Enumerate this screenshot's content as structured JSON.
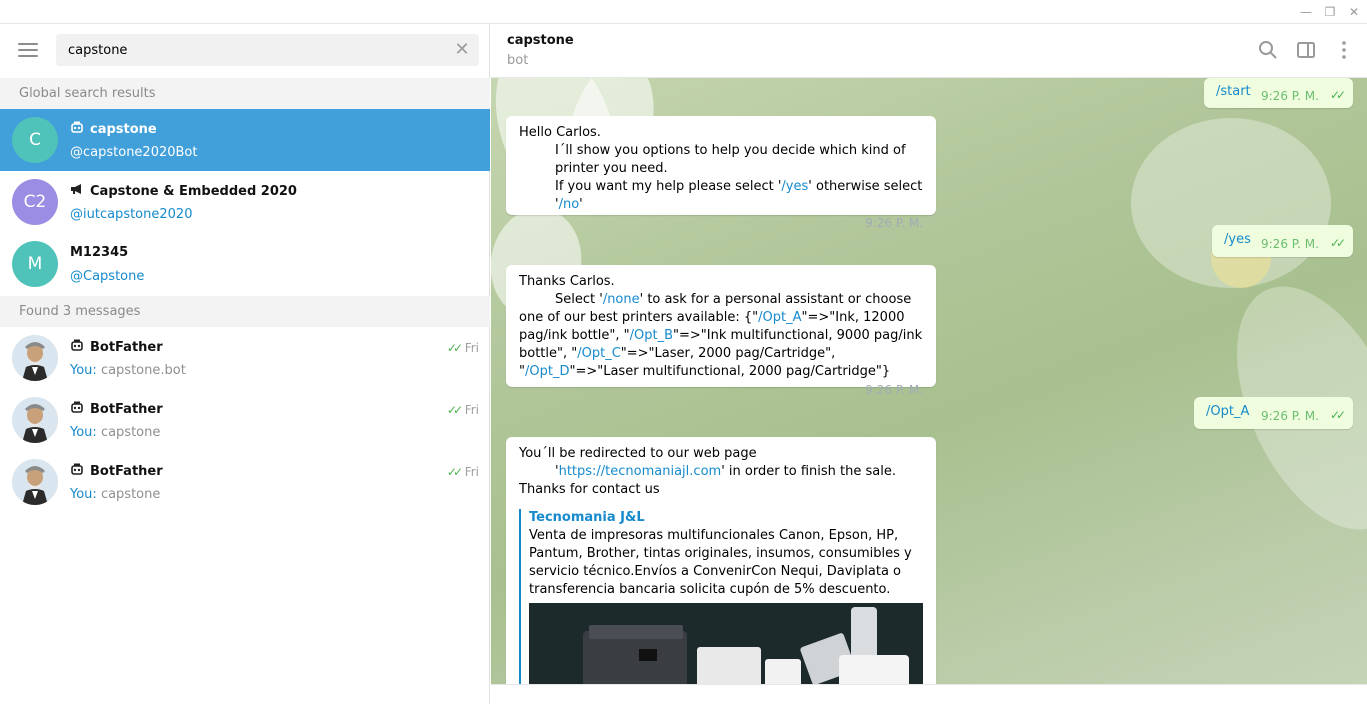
{
  "window": {
    "minimize": "—",
    "restore": "❐",
    "close": "✕"
  },
  "search": {
    "value": "capstone",
    "clear_icon": "✕"
  },
  "sections": {
    "global": "Global search results",
    "messages": "Found 3 messages"
  },
  "global_results": [
    {
      "avatar": "C",
      "avatar_color": "#4fc3b9",
      "icon": "bot",
      "name": "capstone",
      "username": "@capstone2020Bot",
      "active": true
    },
    {
      "avatar": "C2",
      "avatar_color": "#9b8de3",
      "icon": "channel",
      "name": "Capstone & Embedded 2020",
      "username": "@iutcapstone2020",
      "active": false
    },
    {
      "avatar": "M",
      "avatar_color": "#4fc3b9",
      "icon": "",
      "name": "M12345",
      "username": "@Capstone",
      "active": false
    }
  ],
  "message_results": [
    {
      "name": "BotFather",
      "date": "Fri",
      "you": "You:",
      "preview": "capstone.bot"
    },
    {
      "name": "BotFather",
      "date": "Fri",
      "you": "You:",
      "preview": "capstone"
    },
    {
      "name": "BotFather",
      "date": "Fri",
      "you": "You:",
      "preview": "capstone"
    }
  ],
  "chat": {
    "title": "capstone",
    "status": "bot",
    "messages": {
      "m1": {
        "l1": "Hello Carlos.",
        "l2": "I´ll show you options to help you decide which kind of printer you need.",
        "l3a": "If you want my help please select '",
        "l3b": "/yes",
        "l3c": "' otherwise select '",
        "l3d": "/no",
        "l3e": "'",
        "time": "9:26 P. M."
      },
      "m2": {
        "l1": "Thanks Carlos.",
        "l2a": "Select '",
        "l2b": "/none",
        "l2c": "' to ask for a personal assistant or choose one of our best printers available: {\"",
        "l2d": "/Opt_A",
        "l2e": "\"=>\"Ink, 12000 pag/ink bottle\", \"",
        "l2f": "/Opt_B",
        "l2g": "\"=>\"Ink multifunctional, 9000 pag/ink bottle\", \"",
        "l2h": "/Opt_C",
        "l2i": "\"=>\"Laser, 2000 pag/Cartridge\", \"",
        "l2j": "/Opt_D",
        "l2k": "\"=>\"Laser multifunctional, 2000 pag/Cartridge\"}",
        "time": "9:26 P. M."
      },
      "m3": {
        "l1": "You´ll be redirected to our web page",
        "l2a": "'",
        "l2b": "https://tecnomaniajl.com",
        "l2c": "' in order to finish the sale. Thanks for contact us",
        "wp_site": "Tecnomania J&L",
        "wp_desc": "Venta de impresoras multifuncionales Canon, Epson, HP, Pantum, Brother, tintas originales, insumos, consumibles y servicio técnico.Envíos a ConvenirCon Nequi, Daviplata o transferencia bancaria solicita cupón de 5% descuento."
      },
      "out1": {
        "text": "/start",
        "time": "9:26 P. M."
      },
      "out2": {
        "text": "/yes",
        "time": "9:26 P. M."
      },
      "out3": {
        "text": "/Opt_A",
        "time": "9:26 P. M."
      }
    }
  },
  "icons": {
    "menu": "hamburger-icon",
    "search": "search-icon",
    "sidebar": "sidebar-toggle-icon",
    "more": "more-vertical-icon",
    "bot": "bot-icon",
    "channel": "megaphone-icon",
    "check": "double-check-icon"
  },
  "colors": {
    "accent": "#419fd9",
    "link": "#168acd",
    "outgoing_bubble": "#effdde",
    "read_check": "#4cb453"
  }
}
